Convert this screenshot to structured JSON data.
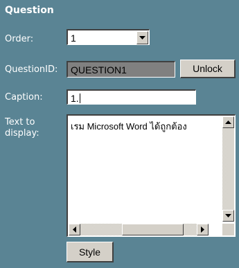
{
  "section": {
    "title": "Question"
  },
  "order": {
    "label": "Order:",
    "value": "1"
  },
  "question_id": {
    "label": "QuestionID:",
    "value": "QUESTION1",
    "unlock_label": "Unlock"
  },
  "caption": {
    "label": "Caption:",
    "value": "1."
  },
  "text_to_display": {
    "label_line1": "Text to",
    "label_line2": "display:",
    "value": "เรม Microsoft Word ได้ถูกต้อง"
  },
  "style_button": {
    "label": "Style"
  },
  "icons": {
    "dropdown": "chevron-down-icon",
    "scroll_up": "arrow-up-icon",
    "scroll_down": "arrow-down-icon",
    "scroll_left": "arrow-left-icon",
    "scroll_right": "arrow-right-icon"
  },
  "colors": {
    "panel_bg": "#5a8494",
    "button_face": "#d4d0c8",
    "locked_field": "#808080"
  }
}
